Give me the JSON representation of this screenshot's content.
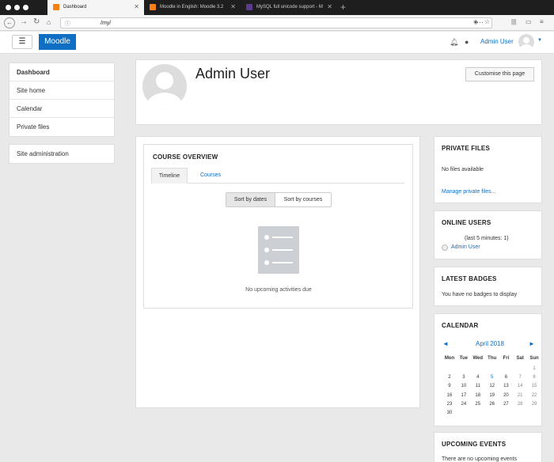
{
  "browser": {
    "tabs": [
      {
        "title": "Dashboard",
        "favicon_color": "#f98012"
      },
      {
        "title": "Moodle in English: Moodle 3.2",
        "favicon_color": "#f98012"
      },
      {
        "title": "MySQL full unicode support - M",
        "favicon_color": "#5b3b8c"
      }
    ],
    "url": "/my/"
  },
  "header": {
    "menu_icon": "hamburger-icon",
    "brand": "Moodle",
    "user_name": "Admin User"
  },
  "nav": {
    "main": [
      {
        "label": "Dashboard",
        "current": true
      },
      {
        "label": "Site home"
      },
      {
        "label": "Calendar"
      },
      {
        "label": "Private files"
      }
    ],
    "admin": [
      {
        "label": "Site administration"
      }
    ]
  },
  "page": {
    "title": "Admin User",
    "customise_label": "Customise this page"
  },
  "course_overview": {
    "title": "COURSE OVERVIEW",
    "tabs": [
      "Timeline",
      "Courses"
    ],
    "sort": [
      "Sort by dates",
      "Sort by courses"
    ],
    "empty_text": "No upcoming activities due"
  },
  "blocks": {
    "private_files": {
      "title": "PRIVATE FILES",
      "text": "No files available",
      "link": "Manage private files..."
    },
    "online_users": {
      "title": "ONLINE USERS",
      "subtitle": "(last 5 minutes: 1)",
      "user": "Admin User"
    },
    "latest_badges": {
      "title": "LATEST BADGES",
      "text": "You have no badges to display"
    },
    "calendar": {
      "title": "CALENDAR",
      "month": "April 2018",
      "prev": "◄",
      "next": "►",
      "days": [
        "Mon",
        "Tue",
        "Wed",
        "Thu",
        "Fri",
        "Sat",
        "Sun"
      ],
      "weeks": [
        [
          "",
          "",
          "",
          "",
          "",
          "",
          "1"
        ],
        [
          "2",
          "3",
          "4",
          "5",
          "6",
          "7",
          "8"
        ],
        [
          "9",
          "10",
          "11",
          "12",
          "13",
          "14",
          "15"
        ],
        [
          "16",
          "17",
          "18",
          "19",
          "20",
          "21",
          "22"
        ],
        [
          "23",
          "24",
          "25",
          "26",
          "27",
          "28",
          "29"
        ],
        [
          "30",
          "",
          "",
          "",
          "",
          "",
          ""
        ]
      ]
    },
    "upcoming_events": {
      "title": "UPCOMING EVENTS",
      "text": "There are no upcoming events"
    }
  }
}
